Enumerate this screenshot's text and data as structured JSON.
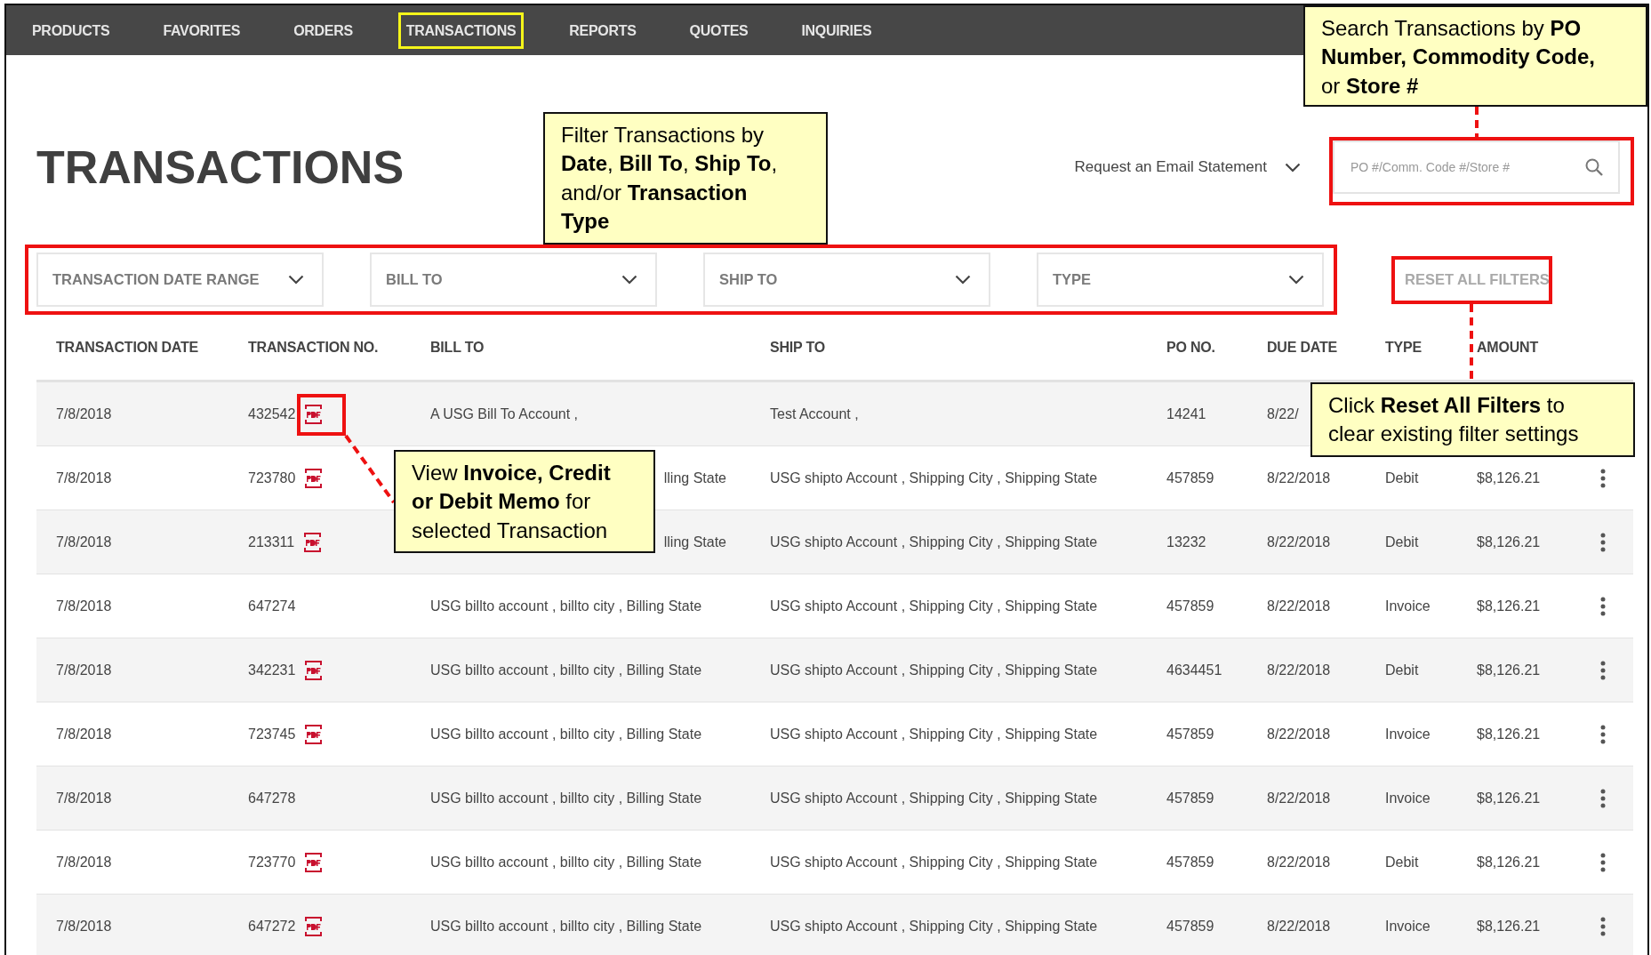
{
  "nav": {
    "tabs": [
      {
        "label": "PRODUCTS",
        "selected": false
      },
      {
        "label": "FAVORITES",
        "selected": false
      },
      {
        "label": "ORDERS",
        "selected": false
      },
      {
        "label": "TRANSACTIONS",
        "selected": true
      },
      {
        "label": "REPORTS",
        "selected": false
      },
      {
        "label": "QUOTES",
        "selected": false
      },
      {
        "label": "INQUIRIES",
        "selected": false
      }
    ]
  },
  "title": "TRANSACTIONS",
  "email_statement": {
    "label": "Request an Email Statement"
  },
  "search": {
    "placeholder": "PO #/Comm. Code #/Store #"
  },
  "filters": [
    {
      "label": "TRANSACTION DATE RANGE"
    },
    {
      "label": "BILL TO"
    },
    {
      "label": "SHIP TO"
    },
    {
      "label": "TYPE"
    }
  ],
  "reset_button": {
    "label": "RESET ALL FILTERS",
    "disabled": true
  },
  "table": {
    "columns": [
      "TRANSACTION DATE",
      "TRANSACTION NO.",
      "BILL TO",
      "SHIP TO",
      "PO NO.",
      "DUE DATE",
      "TYPE",
      "AMOUNT"
    ],
    "rows": [
      {
        "date": "7/8/2018",
        "number": "432542",
        "has_pdf": true,
        "bill_to": "A USG Bill To Account ,",
        "bill_to_clipped": false,
        "ship_to": "Test Account ,",
        "po": "14241",
        "due_date": "8/22/",
        "has_menu": false
      },
      {
        "date": "7/8/2018",
        "number": "723780",
        "has_pdf": true,
        "bill_to": "lling State",
        "bill_to_clipped": true,
        "ship_to": "USG shipto Account , Shipping City , Shipping State",
        "po": "457859",
        "due_date": "8/22/2018",
        "type": "Debit",
        "amount": "$8,126.21",
        "has_menu": true
      },
      {
        "date": "7/8/2018",
        "number": "213311",
        "has_pdf": true,
        "bill_to": "lling State",
        "bill_to_clipped": true,
        "ship_to": "USG shipto Account , Shipping City , Shipping State",
        "po": "13232",
        "due_date": "8/22/2018",
        "type": "Debit",
        "amount": "$8,126.21",
        "has_menu": true
      },
      {
        "date": "7/8/2018",
        "number": "647274",
        "has_pdf": false,
        "bill_to": "USG billto account , billto city , Billing State",
        "bill_to_clipped": false,
        "ship_to": "USG shipto Account , Shipping City , Shipping State",
        "po": "457859",
        "due_date": "8/22/2018",
        "type": "Invoice",
        "amount": "$8,126.21",
        "has_menu": true
      },
      {
        "date": "7/8/2018",
        "number": "342231",
        "has_pdf": true,
        "bill_to": "USG billto account , billto city , Billing State",
        "bill_to_clipped": false,
        "ship_to": "USG shipto Account , Shipping City , Shipping State",
        "po": "4634451",
        "due_date": "8/22/2018",
        "type": "Debit",
        "amount": "$8,126.21",
        "has_menu": true
      },
      {
        "date": "7/8/2018",
        "number": "723745",
        "has_pdf": true,
        "bill_to": "USG billto account , billto city , Billing State",
        "bill_to_clipped": false,
        "ship_to": "USG shipto Account , Shipping City , Shipping State",
        "po": "457859",
        "due_date": "8/22/2018",
        "type": "Invoice",
        "amount": "$8,126.21",
        "has_menu": true
      },
      {
        "date": "7/8/2018",
        "number": "647278",
        "has_pdf": false,
        "bill_to": "USG billto account , billto city , Billing State",
        "bill_to_clipped": false,
        "ship_to": "USG shipto Account , Shipping City , Shipping State",
        "po": "457859",
        "due_date": "8/22/2018",
        "type": "Invoice",
        "amount": "$8,126.21",
        "has_menu": true
      },
      {
        "date": "7/8/2018",
        "number": "723770",
        "has_pdf": true,
        "bill_to": "USG billto account , billto city , Billing State",
        "bill_to_clipped": false,
        "ship_to": "USG shipto Account , Shipping City , Shipping State",
        "po": "457859",
        "due_date": "8/22/2018",
        "type": "Debit",
        "amount": "$8,126.21",
        "has_menu": true
      },
      {
        "date": "7/8/2018",
        "number": "647272",
        "has_pdf": true,
        "bill_to": "USG billto account , billto city , Billing State",
        "bill_to_clipped": false,
        "ship_to": "USG shipto Account , Shipping City , Shipping State",
        "po": "457859",
        "due_date": "8/22/2018",
        "type": "Invoice",
        "amount": "$8,126.21",
        "has_menu": true
      }
    ]
  },
  "callouts": [
    {
      "kind": "search",
      "text": "Search Transactions by **PO Number, Commodity Code,** or **Store #**"
    },
    {
      "kind": "filter",
      "text": "Filter Transactions by **Date**, **Bill To**, **Ship To**, and/or **Transaction Type**"
    },
    {
      "kind": "pdf",
      "text": "View **Invoice, Credit or Debit Memo** for selected Transaction"
    },
    {
      "kind": "reset",
      "text": "Click **Reset All Filters** to clear existing filter settings"
    }
  ]
}
